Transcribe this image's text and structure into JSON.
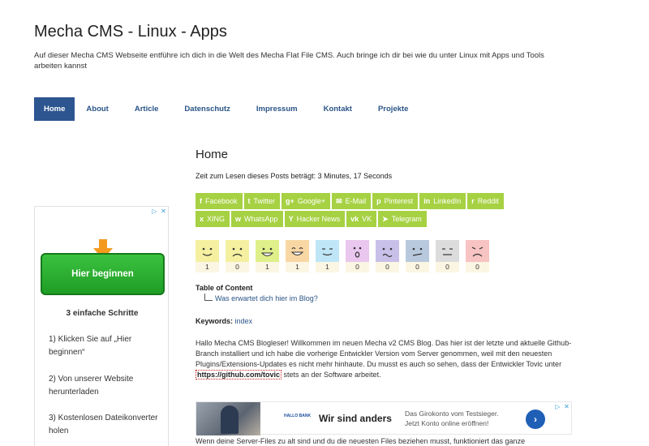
{
  "header": {
    "title": "Mecha CMS - Linux - Apps",
    "description": "Auf dieser Mecha CMS Webseite entführe ich dich in die Welt des Mecha Flat File CMS. Auch bringe ich dir bei wie du unter Linux mit Apps und Tools arbeiten kannst"
  },
  "nav": {
    "items": [
      {
        "label": "Home"
      },
      {
        "label": "About"
      },
      {
        "label": "Article"
      },
      {
        "label": "Datenschutz"
      },
      {
        "label": "Impressum"
      },
      {
        "label": "Kontakt"
      },
      {
        "label": "Projekte"
      }
    ]
  },
  "sidebar_ad": {
    "button_label": "Hier beginnen",
    "steps_title": "3 einfache Schritte",
    "steps": [
      "1) Klicken Sie auf „Hier beginnen“",
      "2) Von unserer Website herunterladen",
      "3) Kostenlosen Dateikonverter holen"
    ]
  },
  "main": {
    "title": "Home",
    "read_time": "Zeit zum Lesen dieses Posts beträgt: 3 Minutes, 17 Seconds"
  },
  "share": {
    "row1": [
      {
        "icon": "f",
        "label": "Facebook"
      },
      {
        "icon": "t",
        "label": "Twitter"
      },
      {
        "icon": "g+",
        "label": "Google+"
      },
      {
        "icon": "✉",
        "label": "E-Mail"
      },
      {
        "icon": "p",
        "label": "Pinterest"
      },
      {
        "icon": "in",
        "label": "LinkedIn"
      },
      {
        "icon": "r",
        "label": "Reddit"
      }
    ],
    "row2": [
      {
        "icon": "x",
        "label": "XING"
      },
      {
        "icon": "w",
        "label": "WhatsApp"
      },
      {
        "icon": "Y",
        "label": "Hacker News"
      },
      {
        "icon": "vk",
        "label": "VK"
      },
      {
        "icon": "➤",
        "label": "Telegram"
      }
    ]
  },
  "reactions": [
    {
      "mood": "happy",
      "color": "#f4f0a0",
      "count": "1"
    },
    {
      "mood": "sad",
      "color": "#f4f0a0",
      "count": "0"
    },
    {
      "mood": "grin",
      "color": "#dff08a",
      "count": "1"
    },
    {
      "mood": "laugh",
      "color": "#f9d7a4",
      "count": "1"
    },
    {
      "mood": "content",
      "color": "#bfe6f6",
      "count": "1"
    },
    {
      "mood": "surprised",
      "color": "#e9c7ee",
      "count": "0"
    },
    {
      "mood": "confused",
      "color": "#c8c0e8",
      "count": "0"
    },
    {
      "mood": "unsure",
      "color": "#b9c9dd",
      "count": "0"
    },
    {
      "mood": "neutral",
      "color": "#dcdcdc",
      "count": "0"
    },
    {
      "mood": "angry",
      "color": "#f8c3c3",
      "count": "0"
    }
  ],
  "toc": {
    "title": "Table of Content",
    "items": [
      "Was erwartet dich hier im Blog?"
    ]
  },
  "keywords": {
    "label": "Keywords:",
    "value": "index"
  },
  "article": {
    "paragraph_before": "Hallo Mecha CMS Blogleser! Willkommen im neuen Mecha v2 CMS Blog. Das hier ist der letzte und aktuelle Github-Branch installiert und ich habe die vorherige Entwickler Version vom Server genommen, weil mit den neuesten Plugins/Extensions-Updates es nicht mehr hinhaute. Du musst es auch so sehen, dass der Entwickler Tovic unter ",
    "link": "https://github.com/tovic",
    "paragraph_after": " stets an der Software arbeitet.",
    "paragraph2": "Wenn deine Server-Files zu alt sind und du die neuesten Files beziehen musst, funktioniert das ganze"
  },
  "banner_ad": {
    "logo": "HALLO BANK",
    "headline": "Wir sind anders",
    "subline1": "Das Girokonto vom Testsieger.",
    "subline2": "Jetzt Konto online eröffnen!"
  }
}
